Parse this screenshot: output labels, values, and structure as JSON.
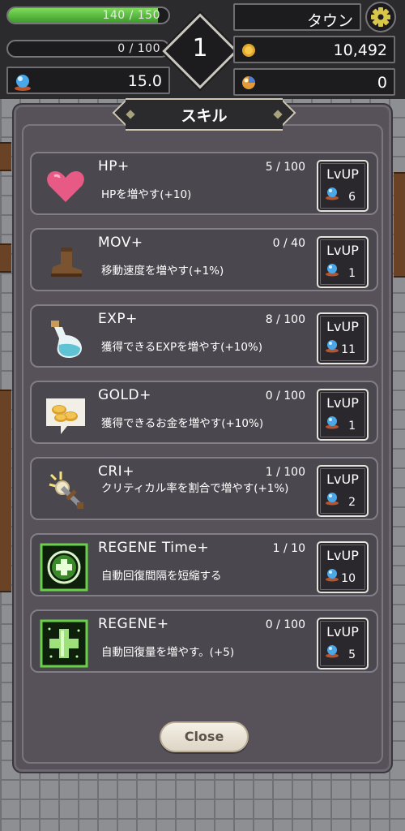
{
  "hud": {
    "hp_text": "140 / 150",
    "hp_fraction": 0.933,
    "exp_text": "0 / 100",
    "exp_fraction": 0.0,
    "crystal_value": "15.0",
    "level": "1",
    "location": "タウン",
    "gold": "10,492",
    "orbs": "0"
  },
  "panel": {
    "title": "スキル",
    "close_label": "Close"
  },
  "skills": [
    {
      "name": "HP+",
      "count": "5 / 100",
      "desc": "HPを増やす(+10)",
      "lvup_label": "LvUP",
      "cost": "6",
      "icon": "heart-icon"
    },
    {
      "name": "MOV+",
      "count": "0 / 40",
      "desc": "移動速度を増やす(+1%)",
      "lvup_label": "LvUP",
      "cost": "1",
      "icon": "boot-icon"
    },
    {
      "name": "EXP+",
      "count": "8 / 100",
      "desc": "獲得できるEXPを増やす(+10%)",
      "lvup_label": "LvUP",
      "cost": "11",
      "icon": "potion-icon"
    },
    {
      "name": "GOLD+",
      "count": "0 / 100",
      "desc": "獲得できるお金を増やす(+10%)",
      "lvup_label": "LvUP",
      "cost": "1",
      "icon": "coins-icon"
    },
    {
      "name": "CRI+",
      "count": "1 / 100",
      "desc": "クリティカル率を割合で増やす(+1%)",
      "lvup_label": "LvUP",
      "cost": "2",
      "icon": "sword-icon"
    },
    {
      "name": "REGENE Time+",
      "count": "1 / 10",
      "desc": "自動回復間隔を短縮する",
      "lvup_label": "LvUP",
      "cost": "10",
      "icon": "regen-circle-icon"
    },
    {
      "name": "REGENE+",
      "count": "0 / 100",
      "desc": "自動回復量を増やす。(+5)",
      "lvup_label": "LvUP",
      "cost": "5",
      "icon": "regen-plus-icon"
    }
  ]
}
